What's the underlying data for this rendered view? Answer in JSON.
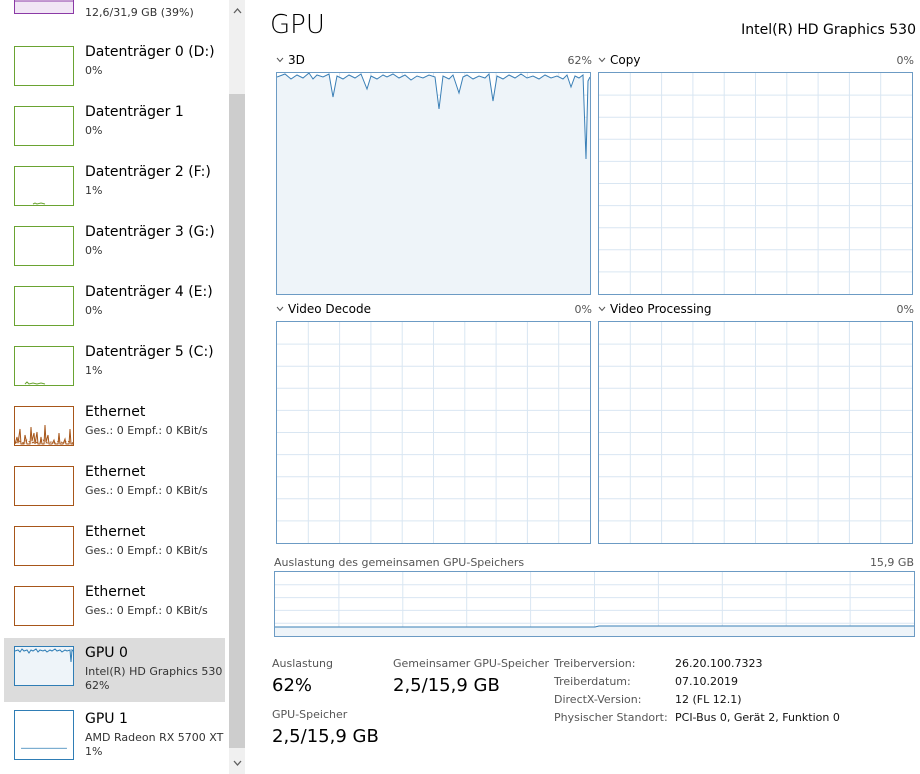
{
  "colors": {
    "memory": "#8b3aa6",
    "disk": "#6aa332",
    "ethernet": "#a7561a",
    "gpu": "#2f7db5",
    "selected_bg": "#dcdcdc"
  },
  "sidebar": {
    "memory_top": {
      "text": "12,6/31,9 GB (39%)"
    },
    "disks": [
      {
        "title": "Datenträger 0 (D:)",
        "value": "0%"
      },
      {
        "title": "Datenträger 1",
        "value": "0%"
      },
      {
        "title": "Datenträger 2 (F:)",
        "value": "1%"
      },
      {
        "title": "Datenträger 3 (G:)",
        "value": "0%"
      },
      {
        "title": "Datenträger 4 (E:)",
        "value": "0%"
      },
      {
        "title": "Datenträger 5 (C:)",
        "value": "1%"
      }
    ],
    "ethernet": [
      {
        "title": "Ethernet",
        "value": "Ges.: 0 Empf.: 0 KBit/s"
      },
      {
        "title": "Ethernet",
        "value": "Ges.: 0 Empf.: 0 KBit/s"
      },
      {
        "title": "Ethernet",
        "value": "Ges.: 0 Empf.: 0 KBit/s"
      },
      {
        "title": "Ethernet",
        "value": "Ges.: 0 Empf.: 0 KBit/s"
      }
    ],
    "gpus": [
      {
        "title": "GPU 0",
        "model": "Intel(R) HD Graphics 530",
        "value": "62%"
      },
      {
        "title": "GPU 1",
        "model": "AMD Radeon RX 5700 XT",
        "value": "1%"
      }
    ]
  },
  "main": {
    "title": "GPU",
    "gpu_name": "Intel(R) HD Graphics 530",
    "engines": [
      {
        "label": "3D",
        "percent": "62%"
      },
      {
        "label": "Copy",
        "percent": "0%"
      },
      {
        "label": "Video Decode",
        "percent": "0%"
      },
      {
        "label": "Video Processing",
        "percent": "0%"
      }
    ],
    "shared_memory": {
      "label": "Auslastung des gemeinsamen GPU-Speichers",
      "max": "15,9 GB"
    },
    "stats": {
      "auslastung_label": "Auslastung",
      "auslastung_value": "62%",
      "shared_label": "Gemeinsamer GPU-Speicher",
      "shared_value": "2,5/15,9 GB",
      "gpu_mem_label": "GPU-Speicher",
      "gpu_mem_value": "2,5/15,9 GB"
    },
    "info": [
      {
        "key": "Treiberversion:",
        "value": "26.20.100.7323"
      },
      {
        "key": "Treiberdatum:",
        "value": "07.10.2019"
      },
      {
        "key": "DirectX-Version:",
        "value": "12 (FL 12.1)"
      },
      {
        "key": "Physischer Standort:",
        "value": "PCI-Bus 0, Gerät 2, Funktion 0"
      }
    ]
  }
}
